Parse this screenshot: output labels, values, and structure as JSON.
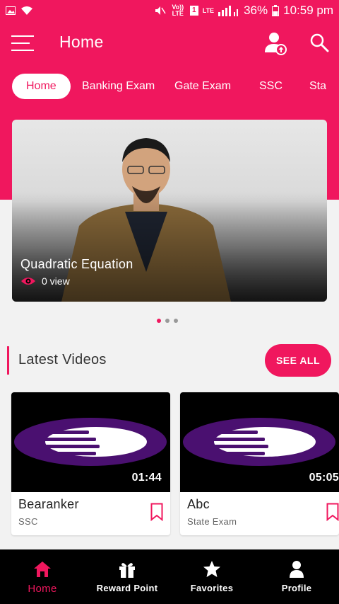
{
  "status_bar": {
    "volte": "Vo)) LTE",
    "sim": "1",
    "lte": "LTE",
    "battery": "36%",
    "time": "10:59 pm"
  },
  "app_bar": {
    "title": "Home"
  },
  "tabs": [
    {
      "label": "Home",
      "active": true
    },
    {
      "label": "Banking Exam"
    },
    {
      "label": "Gate Exam"
    },
    {
      "label": "SSC"
    },
    {
      "label": "Sta"
    }
  ],
  "hero": {
    "title": "Quadratic Equation",
    "views": "0 view"
  },
  "carousel": {
    "count": 3,
    "active_index": 0
  },
  "latest": {
    "title": "Latest Videos",
    "see_all": "SEE ALL",
    "videos": [
      {
        "title": "Bearanker",
        "category": "SSC",
        "duration": "01:44"
      },
      {
        "title": "Abc",
        "category": "State Exam",
        "duration": "05:05"
      }
    ]
  },
  "bottom_nav": [
    {
      "label": "Home",
      "icon": "home-icon",
      "active": true
    },
    {
      "label": "Reward Point",
      "icon": "gift-icon"
    },
    {
      "label": "Favorites",
      "icon": "star-icon"
    },
    {
      "label": "Profile",
      "icon": "person-icon"
    }
  ],
  "colors": {
    "accent": "#f0175e",
    "nav_bg": "#000000",
    "background": "#f2f2f2"
  }
}
